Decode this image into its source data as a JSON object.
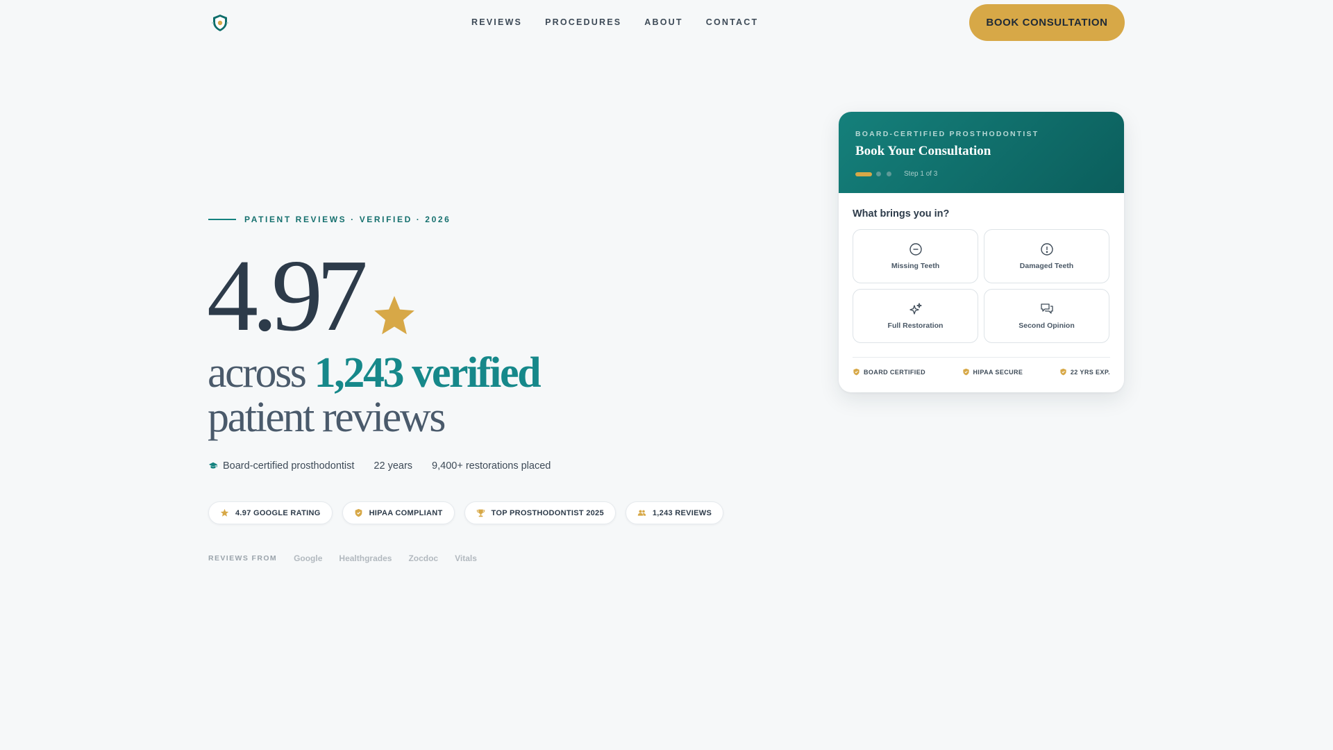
{
  "header": {
    "logo_icon": "shield-logo-icon",
    "nav": [
      {
        "label": "REVIEWS"
      },
      {
        "label": "PROCEDURES"
      },
      {
        "label": "ABOUT"
      },
      {
        "label": "CONTACT"
      }
    ],
    "cta_label": "BOOK CONSULTATION"
  },
  "hero": {
    "eyebrow": "PATIENT REVIEWS · VERIFIED · 2026",
    "rating": "4.97",
    "rating_icon": "star-icon",
    "headline_pre": "across",
    "headline_accent": "1,243 verified",
    "headline_post": "patient reviews",
    "credentials": {
      "icon": "graduation-cap-icon",
      "item1": "Board-certified prosthodontist",
      "item2": "22 years",
      "item3": "9,400+ restorations placed"
    },
    "badges": [
      {
        "label": "4.97 GOOGLE RATING",
        "icon": "star-icon"
      },
      {
        "label": "HIPAA COMPLIANT",
        "icon": "shield-icon"
      },
      {
        "label": "TOP PROSTHODONTIST 2025",
        "icon": "trophy-icon"
      },
      {
        "label": "1,243 REVIEWS",
        "icon": "users-icon"
      }
    ],
    "sources_label": "REVIEWS FROM",
    "sources": [
      "Google",
      "Healthgrades",
      "Zocdoc",
      "Vitals"
    ]
  },
  "card": {
    "eyebrow": "BOARD-CERTIFIED PROSTHODONTIST",
    "title": "Book Your Consultation",
    "step_text": "Step 1 of 3",
    "question": "What brings you in?",
    "options": [
      {
        "label": "Missing Teeth",
        "icon": "minus-circle-icon"
      },
      {
        "label": "Damaged Teeth",
        "icon": "alert-circle-icon"
      },
      {
        "label": "Full Restoration",
        "icon": "sparkles-icon"
      },
      {
        "label": "Second Opinion",
        "icon": "chat-bubbles-icon"
      }
    ],
    "footer": [
      {
        "label": "BOARD CERTIFIED",
        "icon": "shield-check-icon"
      },
      {
        "label": "HIPAA SECURE",
        "icon": "shield-check-icon"
      },
      {
        "label": "22 YRS EXP.",
        "icon": "shield-check-icon"
      }
    ]
  },
  "colors": {
    "accent_teal": "#16888a",
    "accent_gold": "#d7a847",
    "background": "#f6f8f9",
    "text_dark": "#2d3b4a"
  }
}
